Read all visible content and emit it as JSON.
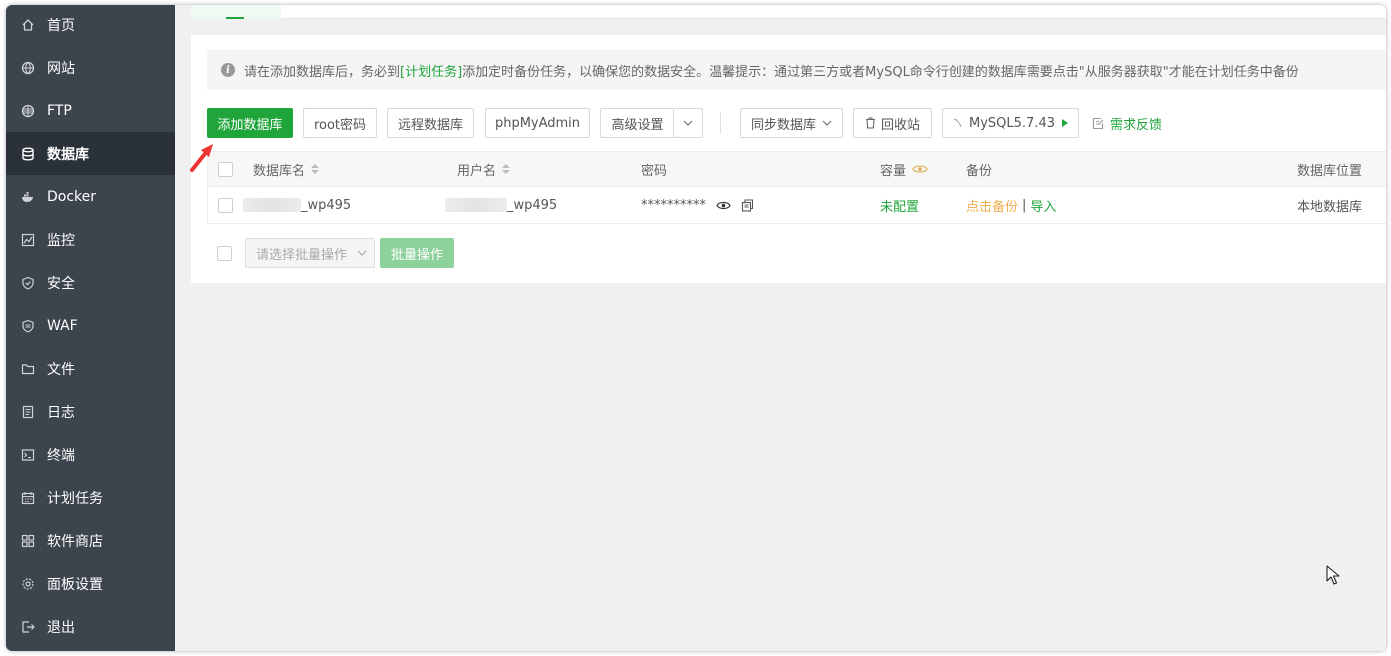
{
  "sidebar": {
    "items": [
      {
        "label": "首页",
        "icon": "home-icon"
      },
      {
        "label": "网站",
        "icon": "globe-icon"
      },
      {
        "label": "FTP",
        "icon": "ftp-globe-icon"
      },
      {
        "label": "数据库",
        "icon": "database-icon",
        "active": true
      },
      {
        "label": "Docker",
        "icon": "docker-icon"
      },
      {
        "label": "监控",
        "icon": "monitor-chart-icon"
      },
      {
        "label": "安全",
        "icon": "shield-icon"
      },
      {
        "label": "WAF",
        "icon": "waf-shield-icon"
      },
      {
        "label": "文件",
        "icon": "folder-icon"
      },
      {
        "label": "日志",
        "icon": "log-icon"
      },
      {
        "label": "终端",
        "icon": "terminal-icon"
      },
      {
        "label": "计划任务",
        "icon": "calendar-icon"
      },
      {
        "label": "软件商店",
        "icon": "apps-grid-icon"
      },
      {
        "label": "面板设置",
        "icon": "gear-icon"
      },
      {
        "label": "退出",
        "icon": "logout-icon"
      }
    ]
  },
  "notice": {
    "before": "请在添加数据库后，务必到",
    "link": "[计划任务]",
    "after": "添加定时备份任务，以确保您的数据安全。温馨提示：通过第三方或者MySQL命令行创建的数据库需要点击\"从服务器获取\"才能在计划任务中备份"
  },
  "toolbar": {
    "add_db": "添加数据库",
    "root_pwd": "root密码",
    "remote_db": "远程数据库",
    "phpmyadmin": "phpMyAdmin",
    "advanced": "高级设置",
    "sync_db": "同步数据库",
    "recycle": "回收站",
    "mysql_version": "MySQL5.7.43",
    "feedback": "需求反馈"
  },
  "table": {
    "headers": {
      "db_name": "数据库名",
      "username": "用户名",
      "password": "密码",
      "capacity": "容量",
      "backup": "备份",
      "location": "数据库位置"
    },
    "rows": [
      {
        "db_name_suffix": "_wp495",
        "username_suffix": "_wp495",
        "password": "**********",
        "capacity": "未配置",
        "backup_link": "点击备份",
        "separator": "|",
        "import_link": "导入",
        "location": "本地数据库"
      }
    ]
  },
  "batch": {
    "select_placeholder": "请选择批量操作",
    "button": "批量操作"
  },
  "colors": {
    "brand_green": "#20a53a",
    "sidebar_bg": "#3c444d",
    "sidebar_active": "#2a3138",
    "orange": "#f0ad4e"
  }
}
